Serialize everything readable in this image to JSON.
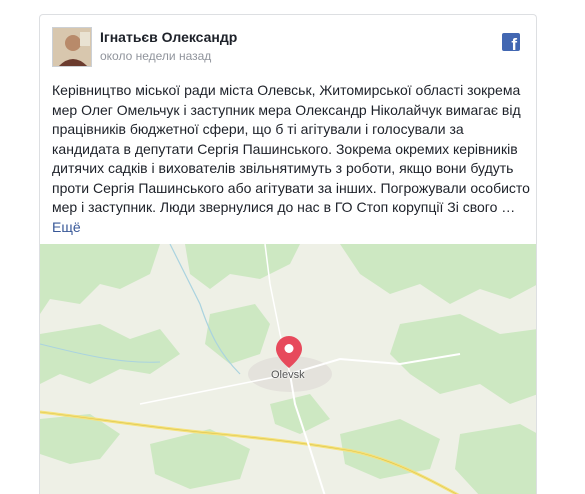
{
  "post": {
    "author": "Ігнатьєв Олександр",
    "time": "около недели назад",
    "text": "Керівництво міської ради міста Олевськ, Житомирської області зокрема мер Олег Омельчук і заступник мера Олександр Ніколайчук вимагає від працівників бюджетної сфери, що б ті агітували і голосували за кандидата в депутати Сергія Пашинського. Зокрема окремих керівників дитячих садків і вихователів звільнятимуть з роботи, якщо вони будуть проти Сергія Пашинського або агітувати за інших. Погрожували особисто мер і заступник. Люди звернулися до нас в ГО Стоп корупції Зі свого …",
    "see_more": "Ещё"
  },
  "header": {
    "logo_icon": "facebook-icon",
    "logo_letter": "f",
    "brand_color": "#4267b2"
  },
  "map": {
    "city_label": "Olevsk",
    "pin_icon": "map-pin-icon",
    "pin_color": "#e74a5c"
  }
}
